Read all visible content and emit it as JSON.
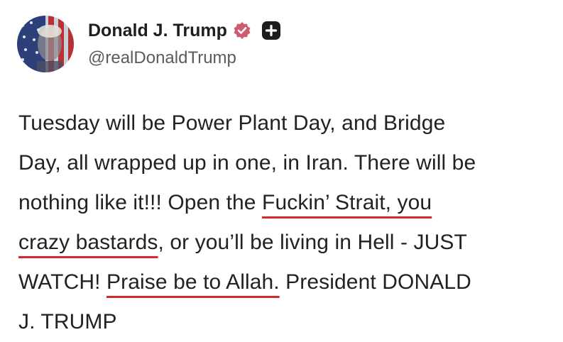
{
  "author": {
    "display_name": "Donald J. Trump",
    "handle": "@realDonaldTrump",
    "verified_icon": "verified-badge-icon",
    "follow_icon": "plus-icon",
    "colors": {
      "verified": "#d05a6e",
      "follow_bg": "#1c1c1c"
    }
  },
  "post": {
    "lines": [
      [
        {
          "text": "Tuesday will be Power Plant Day, and Bridge"
        }
      ],
      [
        {
          "text": "Day, all wrapped up in one, in Iran. There will be"
        }
      ],
      [
        {
          "text": "nothing like it!!! Open the "
        },
        {
          "text": "Fuckin’ Strait, you",
          "underlined": true
        }
      ],
      [
        {
          "text": "crazy bastards",
          "underlined": true
        },
        {
          "text": ", or you’ll be living in Hell - JUST"
        }
      ],
      [
        {
          "text": "WATCH! "
        },
        {
          "text": "Praise be to Allah.",
          "underlined": true
        },
        {
          "text": " President DONALD"
        }
      ],
      [
        {
          "text": "J. TRUMP"
        }
      ]
    ],
    "underline_color": "#d6292b"
  }
}
